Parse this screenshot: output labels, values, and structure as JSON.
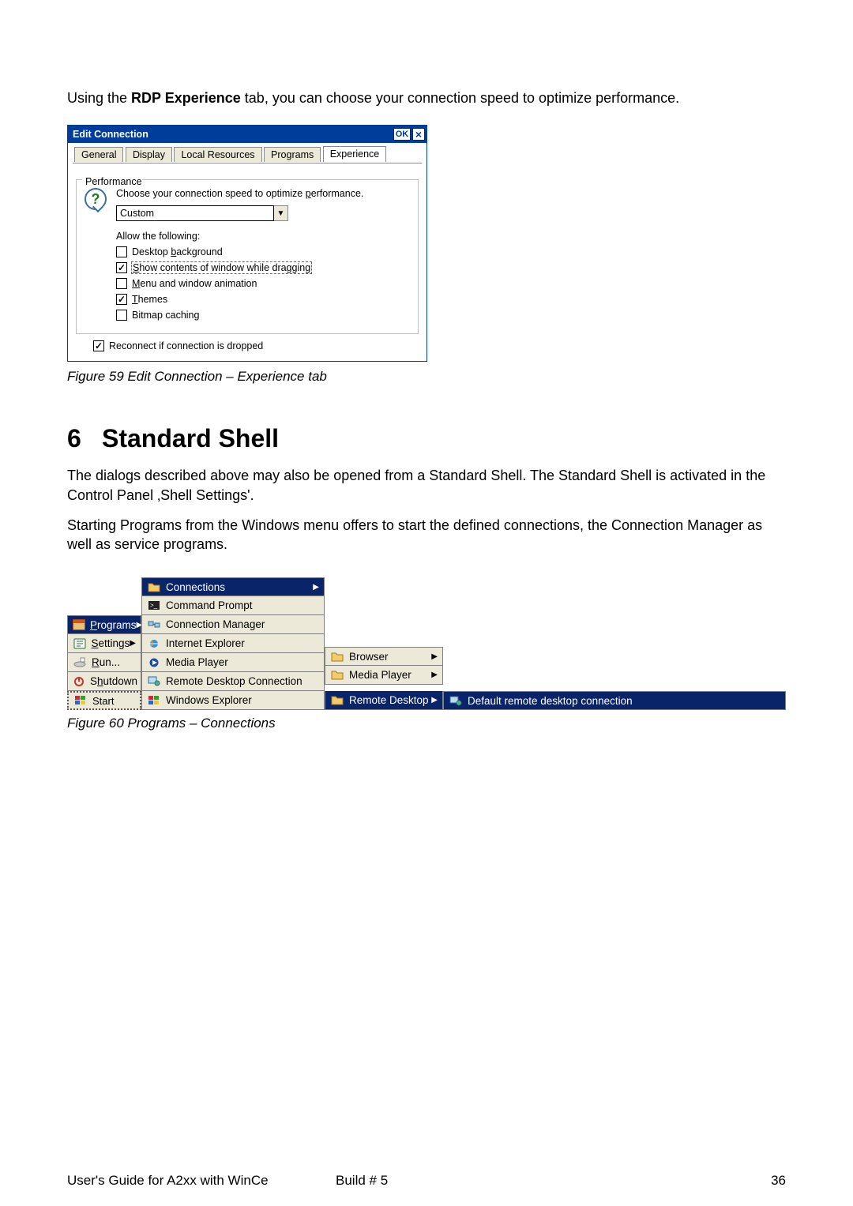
{
  "intro": {
    "prefix": "Using the ",
    "bold": "RDP Experience",
    "suffix": " tab, you can choose your connection speed to optimize performance."
  },
  "dialog": {
    "title": "Edit Connection",
    "ok": "OK",
    "tabs": {
      "general": "General",
      "display": "Display",
      "local": "Local Resources",
      "programs": "Programs",
      "experience": "Experience"
    },
    "group_title": "Performance",
    "group_desc_prefix": "Choose your connection speed to optimize ",
    "perf_u": "p",
    "perf_suffix": "erformance.",
    "select_value": "Custom",
    "allow_label": "Allow the following:",
    "checks": {
      "bg_prefix": "Desktop ",
      "bg_u": "b",
      "bg_suffix": "ackground",
      "drag_u": "S",
      "drag_suffix": "how contents of window while dragging",
      "anim_u": "M",
      "anim_suffix": "enu and window animation",
      "themes_u": "T",
      "themes_suffix": "hemes",
      "bitmap": "Bitmap caching"
    },
    "reconnect": "Reconnect if connection is dropped"
  },
  "fig59": "Figure 59 Edit Connection – Experience tab",
  "section": {
    "num": "6",
    "title": "Standard Shell"
  },
  "para1": "The dialogs described above may also be opened from a Standard Shell. The Standard Shell is activated in the Control Panel ‚Shell Settings'.",
  "para2": "Starting Programs from the  Windows menu offers to start the defined connections, the Connection Manager as well as service programs.",
  "menu": {
    "col1": {
      "programs_u": "P",
      "programs": "rograms",
      "settings_u": "S",
      "settings": "ettings",
      "run_u": "R",
      "run": "un...",
      "shutdown_pre": "S",
      "shutdown_u": "h",
      "shutdown": "utdown",
      "start": "Start"
    },
    "col2": {
      "connections": "Connections",
      "cmd": "Command Prompt",
      "connmgr": "Connection Manager",
      "ie": "Internet Explorer",
      "mp": "Media Player",
      "rdc": "Remote Desktop Connection",
      "we": "Windows Explorer"
    },
    "col3": {
      "browser": "Browser",
      "mp": "Media Player",
      "rd": "Remote Desktop"
    },
    "col4": {
      "def": "Default remote desktop connection"
    }
  },
  "fig60": "Figure 60 Programs – Connections",
  "footer": {
    "left": "User's Guide for A2xx with WinCe",
    "center": "Build # 5",
    "right": "36"
  }
}
